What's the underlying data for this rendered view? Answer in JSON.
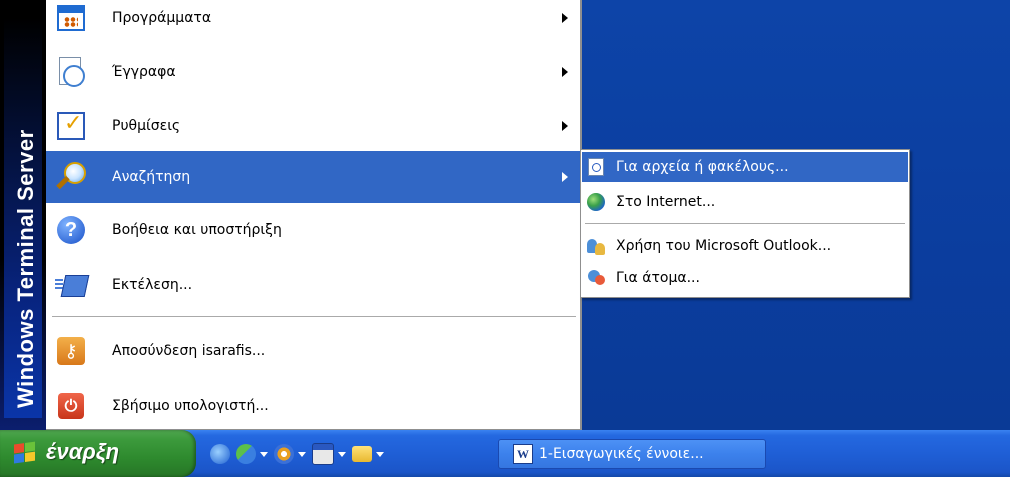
{
  "start_menu": {
    "banner": "Windows Terminal Server",
    "items": [
      {
        "label": "Προγράμματα",
        "icon": "programs-icon",
        "submenu": true
      },
      {
        "label": "Έγγραφα",
        "icon": "documents-icon",
        "submenu": true
      },
      {
        "label": "Ρυθμίσεις",
        "icon": "settings-icon",
        "submenu": true
      },
      {
        "label": "Αναζήτηση",
        "icon": "search-icon",
        "submenu": true,
        "active": true
      },
      {
        "label": "Βοήθεια και υποστήριξη",
        "icon": "help-icon",
        "submenu": false
      },
      {
        "label": "Εκτέλεση...",
        "icon": "run-icon",
        "submenu": false
      },
      {
        "label": "Αποσύνδεση isarafis...",
        "icon": "logoff-icon",
        "submenu": false
      },
      {
        "label": "Σβήσιμο υπολογιστή...",
        "icon": "shutdown-icon",
        "submenu": false
      }
    ]
  },
  "search_submenu": {
    "items": [
      {
        "label": "Για αρχεία ή φακέλους...",
        "icon": "file-search-icon",
        "active": true
      },
      {
        "label": "Στο Internet...",
        "icon": "internet-icon"
      },
      {
        "label": "Χρήση του Microsoft Outlook...",
        "icon": "outlook-icon"
      },
      {
        "label": "Για άτομα...",
        "icon": "people-icon"
      }
    ]
  },
  "taskbar": {
    "start_label": "έναρξη",
    "quick_launch": [
      "ie-icon",
      "messenger-icon",
      "media-player-icon",
      "window-icon",
      "folder-icon"
    ],
    "task_window_label": "1-Εισαγωγικές έννοιε..."
  },
  "colors": {
    "highlight": "#3167c5",
    "desktop": "#0b3d9e",
    "start_button": "#2e8a2e"
  }
}
